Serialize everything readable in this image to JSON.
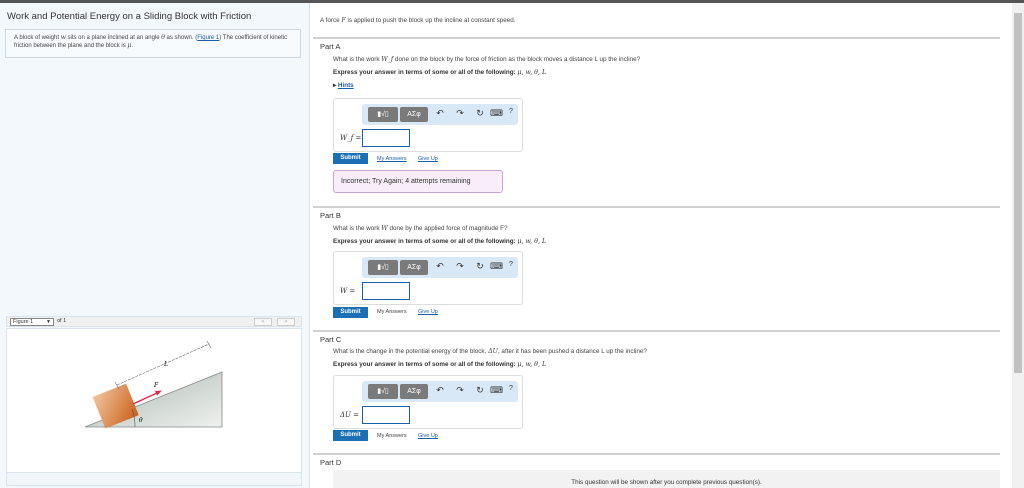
{
  "left": {
    "title": "Work and Potential Energy on a Sliding Block with Friction",
    "intro_pre": "A block of weight ",
    "intro_w": "w",
    "intro_mid": " sits on a plane inclined at an angle ",
    "intro_theta": "θ",
    "intro_mid2": " as shown. (",
    "intro_link": "Figure 1",
    "intro_post": ") The coefficient of kinetic friction between the plane and the block is ",
    "intro_mu": "μ",
    "intro_end": ".",
    "figure_select": "Figure 1",
    "figure_of": "of 1",
    "prev": "<",
    "next": ">",
    "fig_labels": {
      "L": "L",
      "F": "F",
      "theta": "θ"
    },
    "colors": {
      "block": "#d9773a",
      "arrow": "#e8234a",
      "incline": "#b7c2bb"
    }
  },
  "main": {
    "intro": "A force F is applied to push the block up the incline at constant speed.",
    "intro_pre": "A force ",
    "intro_F": "F",
    "intro_post": " is applied to push the block up the incline at constant speed.",
    "express": "Express your answer in terms of some or all of the following: ",
    "vars": "μ, w, θ, L",
    "toolbar": {
      "templates": "▮√▯",
      "greek": "ΑΣφ",
      "undo": "↶",
      "redo": "↷",
      "reset": "↻",
      "keyboard": "⌨",
      "help": "?"
    },
    "submit": "Submit",
    "my_answers": "My Answers",
    "give_up": "Give Up",
    "partA": {
      "label": "Part A",
      "q_pre": "What is the work ",
      "q_var": "W_f",
      "q_post": " done on the block by the force of friction as the block moves a distance L up the incline?",
      "hints": "Hints",
      "input_label": "W_f =",
      "feedback": "Incorrect; Try Again; 4 attempts remaining"
    },
    "partB": {
      "label": "Part B",
      "q_pre": "What is the work ",
      "q_var": "W",
      "q_post": " done by the applied force of magnitude F?",
      "input_label": "W ="
    },
    "partC": {
      "label": "Part C",
      "q_pre": "What is the change in the potential energy of the block, ",
      "q_var": "ΔU",
      "q_post": ", after it has been pushed a distance L up the incline?",
      "input_label": "ΔU ="
    },
    "partD": {
      "label": "Part D",
      "message": "This question will be shown after you complete previous question(s)."
    }
  }
}
